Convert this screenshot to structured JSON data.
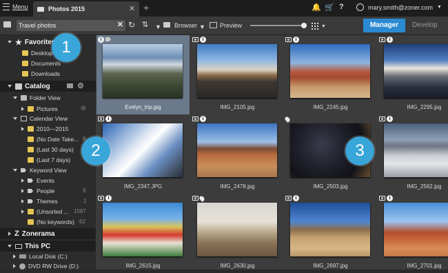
{
  "titlebar": {
    "menu_label": "Menu",
    "tab_label": "Photos 2015",
    "user_email": "mary.smith@zoner.com"
  },
  "toolbar": {
    "search_value": "Travel photos",
    "browser_label": "Browser",
    "preview_label": "Preview",
    "manager_label": "Manager",
    "develop_label": "Develop"
  },
  "sidebar": {
    "favorites": {
      "label": "Favorites",
      "items": [
        "Desktop",
        "Documents",
        "Downloads"
      ]
    },
    "catalog": {
      "label": "Catalog",
      "folder_view": "Folder View",
      "pictures": "Pictures",
      "calendar_view": "Calendar View",
      "calendar_items": [
        "2010—2015",
        "(No Date Take...",
        "(Last 30 days)",
        "(Last 7 days)"
      ],
      "calendar_counts": [
        "",
        "8",
        "",
        ""
      ],
      "keyword_view": "Keyword View",
      "keywords": [
        "Events",
        "People",
        "Themes",
        "(Unsorted ...",
        "(No keywords)"
      ],
      "keyword_counts": [
        "",
        "9",
        "1",
        "1587",
        "62"
      ]
    },
    "zonerama": "Zonerama",
    "this_pc": "This PC",
    "drives": [
      "Local Disk (C:)",
      "DVD RW Drive (D:)"
    ]
  },
  "photos": [
    {
      "name": "Evelyn_trip.jpg"
    },
    {
      "name": "IMG_2105.jpg"
    },
    {
      "name": "IMG_2245.jpg"
    },
    {
      "name": "IMG_2295.jpg"
    },
    {
      "name": "IMG_2347.JPG"
    },
    {
      "name": "IMG_2478.jpg"
    },
    {
      "name": "IMG_2503.jpg"
    },
    {
      "name": "IMG_2562.jpg"
    },
    {
      "name": "IMG_2615.jpg"
    },
    {
      "name": "IMG_2630.jpg"
    },
    {
      "name": "IMG_2697.jpg"
    },
    {
      "name": "IMG_2701.jpg"
    }
  ],
  "callouts": [
    "1",
    "2",
    "3"
  ],
  "colors": {
    "accent": "#2b8ad1",
    "callout": "#39a6da",
    "selection": "#6b7a8b",
    "folder": "#e6c454"
  }
}
